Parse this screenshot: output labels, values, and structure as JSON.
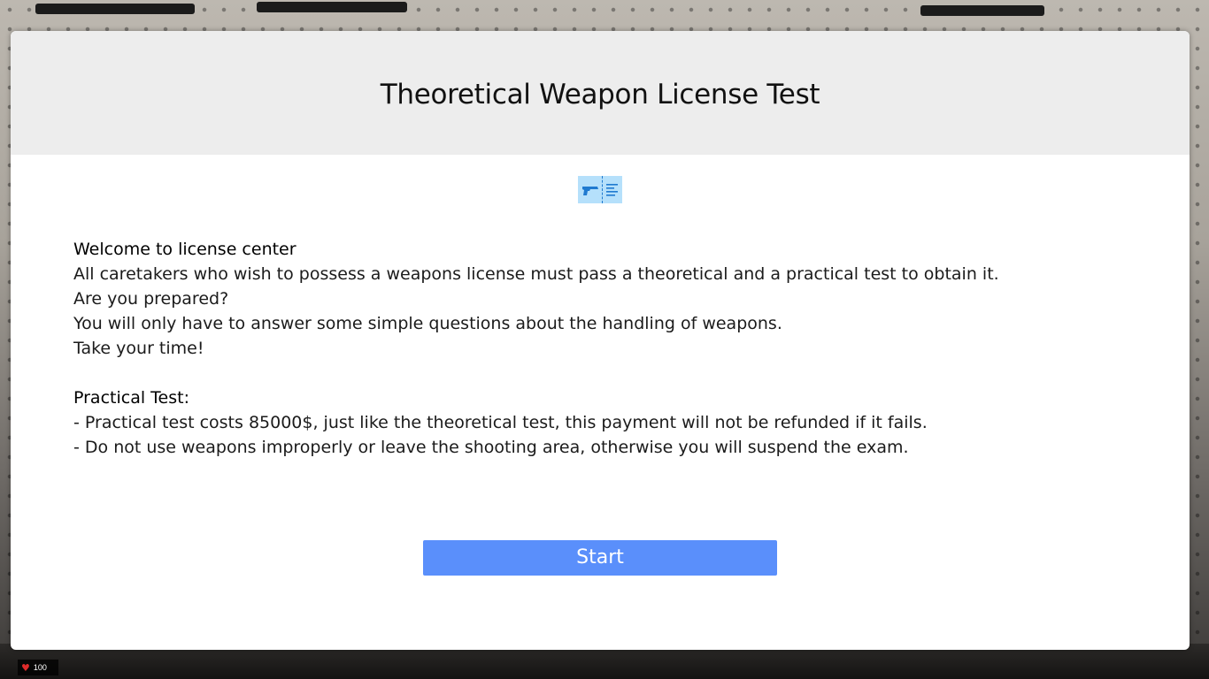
{
  "modal": {
    "title": "Theoretical Weapon License Test",
    "intro_heading": "Welcome to license center",
    "intro_lines": [
      "All caretakers who wish to possess a weapons license must pass a theoretical and a practical test to obtain it.",
      "Are you prepared?",
      "You will only have to answer some simple questions about the handling of weapons.",
      "Take your time!"
    ],
    "practical_heading": "Practical Test:",
    "practical_lines": [
      "- Practical test costs 85000$, just like the theoretical test, this payment will not be refunded if it fails.",
      "- Do not use weapons improperly or leave the shooting area, otherwise you will suspend the exam."
    ],
    "start_label": "Start",
    "badge_icons": [
      "pistol-icon",
      "document-lines-icon"
    ]
  },
  "hud": {
    "health_value": "100",
    "health_icon": "heart-icon"
  },
  "colors": {
    "header_bg": "#ededed",
    "button_bg": "#5a8ffb",
    "badge_bg": "#b5e0fb",
    "icon_blue": "#1f7ad0"
  }
}
